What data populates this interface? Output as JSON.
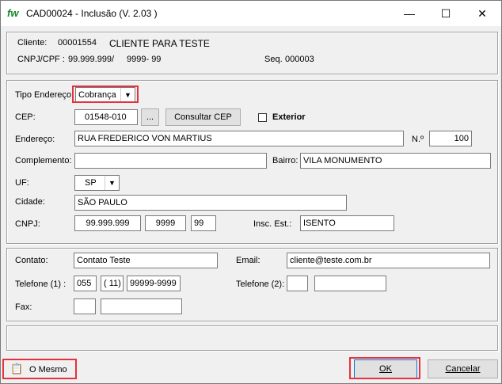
{
  "window": {
    "app_icon": "fw",
    "title": "CAD00024 - Inclusão  (V.  2.03 )",
    "minimize_icon": "minimize-icon",
    "maximize_icon": "maximize-icon",
    "close_icon": "close-icon"
  },
  "header": {
    "cliente_label": "Cliente:",
    "cliente_code": "00001554",
    "cliente_name": "CLIENTE PARA TESTE",
    "cnpj_label": "CNPJ/CPF :",
    "cnpj_value": "99.999.999/",
    "cnpj_suffix": "9999- 99",
    "seq_label": "Seq.",
    "seq_value": "000003"
  },
  "address": {
    "tipo_label": "Tipo Endereço:",
    "tipo_value": "Cobrança",
    "cep_label": "CEP:",
    "cep_value": "01548-010",
    "cep_lookup_btn": "...",
    "consultar_btn": "Consultar CEP",
    "exterior_label": "Exterior",
    "endereco_label": "Endereço:",
    "endereco_value": "RUA FREDERICO VON MARTIUS",
    "numero_label": "N.º",
    "numero_value": "100",
    "complemento_label": "Complemento:",
    "complemento_value": "",
    "bairro_label": "Bairro:",
    "bairro_value": "VILA MONUMENTO",
    "uf_label": "UF:",
    "uf_value": "SP",
    "cidade_label": "Cidade:",
    "cidade_value": "SÃO PAULO",
    "cnpj_label": "CNPJ:",
    "cnpj_part1": "99.999.999",
    "cnpj_part2": "9999",
    "cnpj_part3": "99",
    "insc_label": "Insc. Est.:",
    "insc_value": "ISENTO"
  },
  "contact": {
    "contato_label": "Contato:",
    "contato_value": "Contato Teste",
    "email_label": "Email:",
    "email_value": "cliente@teste.com.br",
    "tel1_label": "Telefone (1) :",
    "tel1_ddi": "055",
    "tel1_ddd": "( 11)",
    "tel1_num": "99999-9999",
    "tel2_label": "Telefone (2):",
    "tel2_ddd": "",
    "tel2_num": "",
    "fax_label": "Fax:",
    "fax_ddd": "",
    "fax_num": ""
  },
  "footer": {
    "mesmo_label": "O Mesmo",
    "ok_label": "OK",
    "cancel_label": "Cancelar"
  },
  "accent_colors": {
    "highlight": "#e5323e",
    "app_icon": "#1a8a2a"
  }
}
